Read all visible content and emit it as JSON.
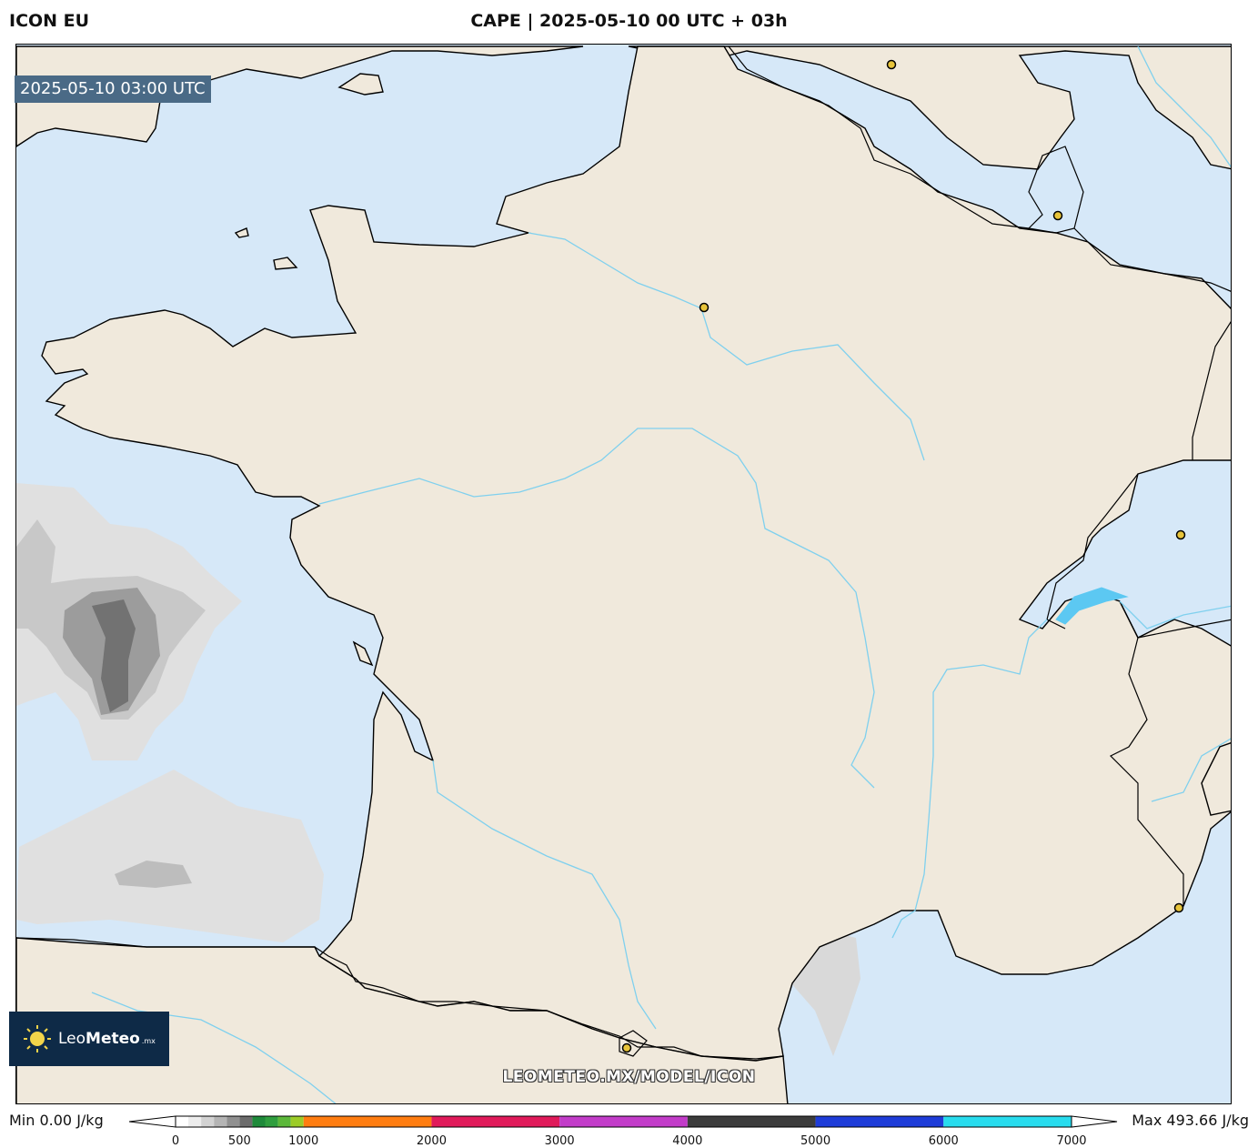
{
  "header": {
    "model_name": "ICON EU",
    "title": "CAPE | 2025-05-10 00 UTC + 03h"
  },
  "map": {
    "timestamp": "2025-05-10 03:00 UTC",
    "watermark": "LEOMETEO.MX/MODEL/ICON",
    "colors": {
      "ocean": "#d6e8f8",
      "land": "#f0e9dc",
      "river": "#7fd0ee",
      "lake": "#5cc8f2",
      "border": "#000000",
      "city_marker": "#e8c43a"
    }
  },
  "logo": {
    "name_light": "Leo",
    "name_bold": "Meteo",
    "suffix": ".mx",
    "icon": "sun-icon"
  },
  "colorbar": {
    "min_label": "Min 0.00 J/kg",
    "max_label": "Max 493.66 J/kg",
    "ticks": [
      "0",
      "500",
      "1000",
      "2000",
      "3000",
      "4000",
      "5000",
      "6000",
      "7000"
    ],
    "stops": [
      {
        "from": 0,
        "to": 100,
        "color": "#ffffff"
      },
      {
        "from": 100,
        "to": 200,
        "color": "#ececec"
      },
      {
        "from": 200,
        "to": 300,
        "color": "#d2d2d2"
      },
      {
        "from": 300,
        "to": 400,
        "color": "#b4b4b4"
      },
      {
        "from": 400,
        "to": 500,
        "color": "#909090"
      },
      {
        "from": 500,
        "to": 600,
        "color": "#6c6c6c"
      },
      {
        "from": 600,
        "to": 700,
        "color": "#1e8a3a"
      },
      {
        "from": 700,
        "to": 800,
        "color": "#2f9e3e"
      },
      {
        "from": 800,
        "to": 900,
        "color": "#5cb83a"
      },
      {
        "from": 900,
        "to": 1000,
        "color": "#9ccc28"
      },
      {
        "from": 1000,
        "to": 2000,
        "color": "#ff7d10"
      },
      {
        "from": 2000,
        "to": 3000,
        "color": "#e01a5a"
      },
      {
        "from": 3000,
        "to": 4000,
        "color": "#c23cc9"
      },
      {
        "from": 4000,
        "to": 5000,
        "color": "#3c3c3c"
      },
      {
        "from": 5000,
        "to": 6000,
        "color": "#1e3cd8"
      },
      {
        "from": 6000,
        "to": 7000,
        "color": "#28dcee"
      }
    ]
  }
}
